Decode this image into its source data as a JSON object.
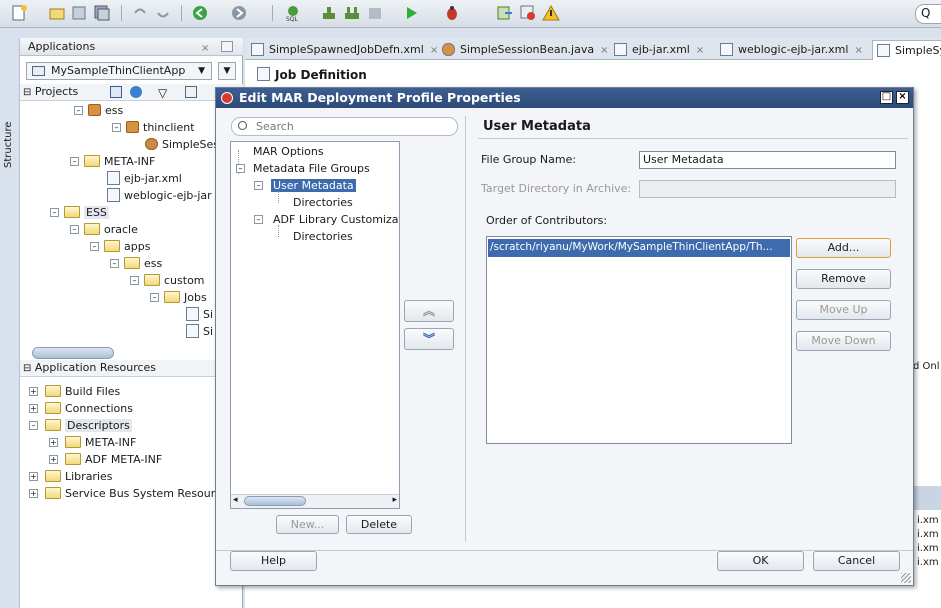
{
  "toolbar": {
    "icons": [
      "new-icon",
      "open-icon",
      "save-icon",
      "save-all-icon",
      "undo-icon",
      "redo-icon",
      "back-icon",
      "forward-icon",
      "sql-icon",
      "build-icon",
      "build-all-icon",
      "clean-icon",
      "run-icon",
      "debug-icon",
      "deploy-icon",
      "profile-icon",
      "warning-icon",
      "search-icon"
    ]
  },
  "side_strip": {
    "label": "Structure"
  },
  "applications_panel": {
    "title": "Applications",
    "app_selector": "MySampleThinClientApp",
    "projects_label": "Projects",
    "tree": [
      {
        "label": "ess"
      },
      {
        "label": "thinclient"
      },
      {
        "label": "SimpleSes"
      },
      {
        "label": "META-INF"
      },
      {
        "label": "ejb-jar.xml"
      },
      {
        "label": "weblogic-ejb-jar"
      },
      {
        "label": "ESS"
      },
      {
        "label": "oracle"
      },
      {
        "label": "apps"
      },
      {
        "label": "ess"
      },
      {
        "label": "custom"
      },
      {
        "label": "Jobs"
      },
      {
        "label": "Si"
      },
      {
        "label": "Si"
      }
    ],
    "resources_label": "Application Resources",
    "resources_tree": [
      {
        "label": "Build Files"
      },
      {
        "label": "Connections"
      },
      {
        "label": "Descriptors"
      },
      {
        "label": "META-INF"
      },
      {
        "label": "ADF META-INF"
      },
      {
        "label": "Libraries"
      },
      {
        "label": "Service Bus System Resource"
      }
    ]
  },
  "editor": {
    "tabs": [
      {
        "label": "SimpleSpawnedJobDefn.xml"
      },
      {
        "label": "SimpleSessionBean.java"
      },
      {
        "label": "ejb-jar.xml"
      },
      {
        "label": "weblogic-ejb-jar.xml"
      },
      {
        "label": "SimpleSy"
      }
    ],
    "page_title": "Job Definition",
    "right_fragments": [
      "d Onl",
      "i.xm",
      "i.xm",
      "i.xm",
      "i.xm"
    ]
  },
  "dialog": {
    "title": "Edit MAR Deployment Profile Properties",
    "search_placeholder": "Search",
    "nav": [
      {
        "label": "MAR Options"
      },
      {
        "label": "Metadata File Groups"
      },
      {
        "label": "User Metadata"
      },
      {
        "label": "Directories"
      },
      {
        "label": "ADF Library Customizat"
      },
      {
        "label": "Directories"
      }
    ],
    "new_button": "New...",
    "delete_button": "Delete",
    "up_arrow": "︽",
    "down_arrow": "︾",
    "section_title": "User Metadata",
    "file_group_label": "File Group Name:",
    "file_group_value": "User Metadata",
    "target_dir_label": "Target Directory in Archive:",
    "target_dir_value": "",
    "contributors_label": "Order of Contributors:",
    "contributors": [
      "/scratch/riyanu/MyWork/MySampleThinClientApp/Th..."
    ],
    "add_button": "Add...",
    "remove_button": "Remove",
    "move_up_button": "Move Up",
    "move_down_button": "Move Down",
    "help_button": "Help",
    "ok_button": "OK",
    "cancel_button": "Cancel"
  }
}
